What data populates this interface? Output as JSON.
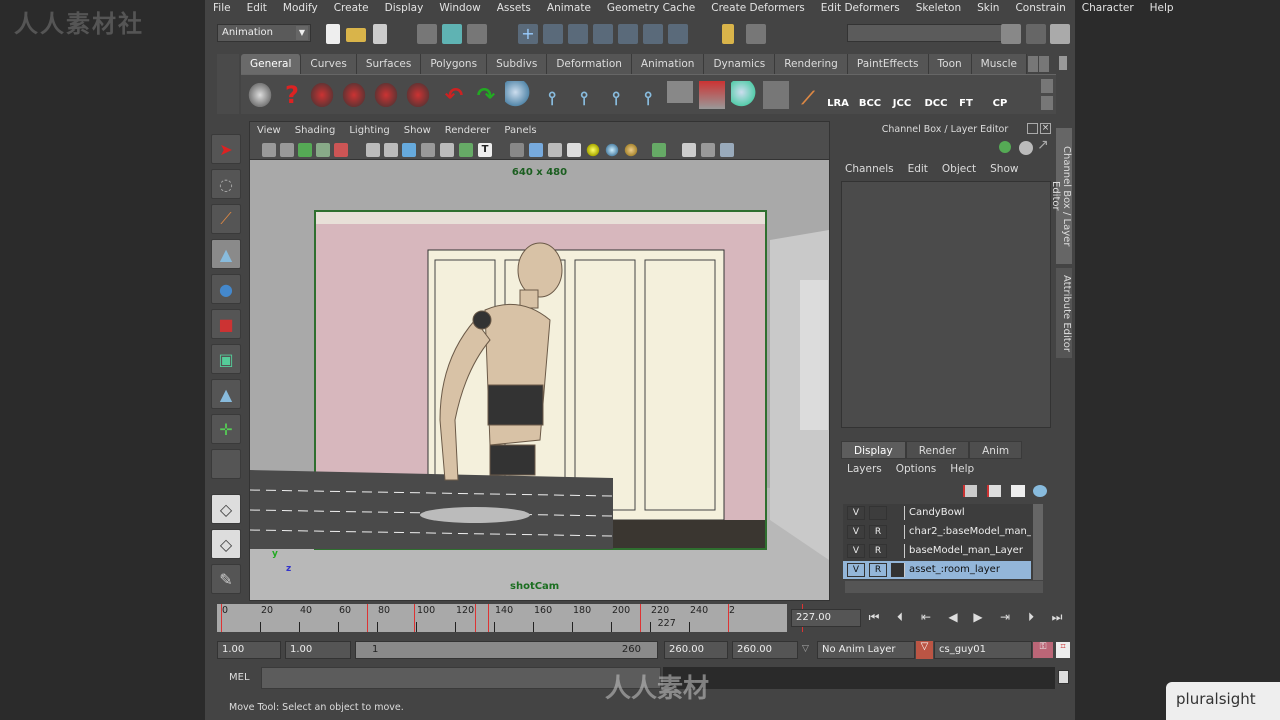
{
  "watermarks": {
    "top_left": "人人素材社",
    "center": "人人素材",
    "brand": "pluralsight"
  },
  "menu": [
    "File",
    "Edit",
    "Modify",
    "Create",
    "Display",
    "Window",
    "Assets",
    "Animate",
    "Geometry Cache",
    "Create Deformers",
    "Edit Deformers",
    "Skeleton",
    "Skin",
    "Constrain",
    "Character",
    "Help"
  ],
  "status_line": {
    "menu_set": "Animation"
  },
  "shelf": {
    "tabs": [
      "General",
      "Curves",
      "Surfaces",
      "Polygons",
      "Subdivs",
      "Deformation",
      "Animation",
      "Dynamics",
      "Rendering",
      "PaintEffects",
      "Toon",
      "Muscle"
    ],
    "active_tab": "General",
    "text_icons": [
      "LRA",
      "BCC",
      "JCC",
      "DCC",
      "FT",
      "CP"
    ]
  },
  "viewport": {
    "menu": [
      "View",
      "Shading",
      "Lighting",
      "Show",
      "Renderer",
      "Panels"
    ],
    "resolution": "640 x 480",
    "camera": "shotCam",
    "axis_y": "y",
    "axis_z": "z"
  },
  "channel_box": {
    "title": "Channel Box / Layer Editor",
    "menu": [
      "Channels",
      "Edit",
      "Object",
      "Show"
    ],
    "side_tabs": [
      "Channel Box / Layer Editor",
      "Attribute Editor"
    ]
  },
  "layer_editor": {
    "tabs": [
      "Display",
      "Render",
      "Anim"
    ],
    "active_tab": "Display",
    "menu": [
      "Layers",
      "Options",
      "Help"
    ],
    "layers": [
      {
        "v": "V",
        "r": "",
        "name": "CandyBowl"
      },
      {
        "v": "V",
        "r": "R",
        "name": "char2_:baseModel_man_Layer"
      },
      {
        "v": "V",
        "r": "R",
        "name": "baseModel_man_Layer"
      },
      {
        "v": "V",
        "r": "R",
        "name": "asset_:room_layer",
        "selected": true
      }
    ]
  },
  "timeline": {
    "ticks": [
      "0",
      "20",
      "40",
      "60",
      "80",
      "100",
      "120",
      "140",
      "160",
      "180",
      "200",
      "220",
      "240",
      "2"
    ],
    "current_frame_marker": "227",
    "current_time": "227.00"
  },
  "range": {
    "start_time": "1.00",
    "playback_start": "1.00",
    "slider_start": "1",
    "slider_end": "260",
    "playback_end": "260.00",
    "end_time": "260.00",
    "anim_layer": "No Anim Layer",
    "character": "cs_guy01"
  },
  "command_line": {
    "label": "MEL"
  },
  "help_line": {
    "text": "Move Tool: Select an object to move."
  }
}
